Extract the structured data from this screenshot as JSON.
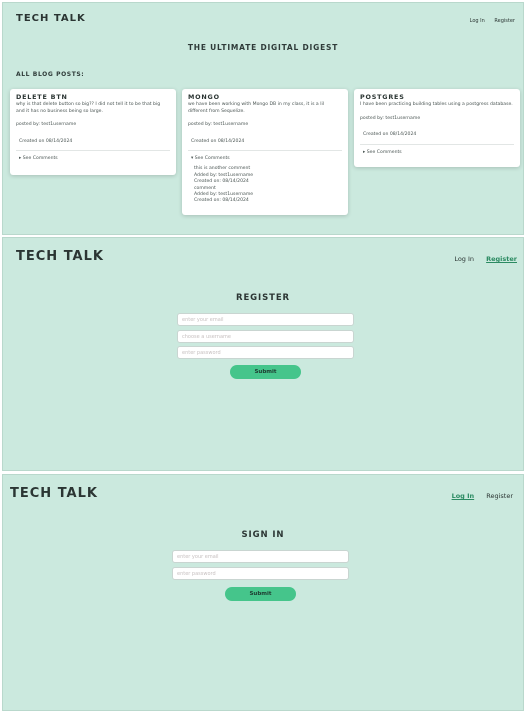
{
  "home": {
    "brand": "Tech Talk",
    "nav": {
      "login": "Log In",
      "register": "Register"
    },
    "title": "The Ultimate Digital Digest",
    "posts_heading": "All Blog Posts:",
    "posts": [
      {
        "title": "Delete BTN",
        "body": "why is that delete button so big?? I did not tell it to be that big and it has no business being so large.",
        "posted_by": "posted by: test1username",
        "created": "Created on 08/14/2024",
        "toggle": "▸ See Comments"
      },
      {
        "title": "Mongo",
        "body": "we have been working with Mongo DB in my class, it is a lil different from Sequelize.",
        "posted_by": "posted by: test1username",
        "created": "Created on 08/14/2024",
        "toggle": "▾ See Comments",
        "comments": [
          {
            "text": "this is another comment",
            "added_by": "Added by: test1username",
            "created": "Created on: 08/14/2024"
          },
          {
            "text": "comment",
            "added_by": "Added by: test1username",
            "created": "Created on: 08/14/2024"
          }
        ]
      },
      {
        "title": "Postgres",
        "body": "I have been practicing building tables using a postgress database.",
        "posted_by": "posted by: test1username",
        "created": "Created on 08/14/2024",
        "toggle": "▸ See Comments"
      }
    ]
  },
  "register_page": {
    "brand": "Tech Talk",
    "nav": {
      "login": "Log In",
      "register": "Register"
    },
    "title": "Register",
    "email_placeholder": "enter your email",
    "username_placeholder": "choose a username",
    "password_placeholder": "enter password",
    "submit": "Submit"
  },
  "login_page": {
    "brand": "Tech Talk",
    "nav": {
      "login": "Log In",
      "register": "Register"
    },
    "title": "Sign In",
    "email_placeholder": "enter your email",
    "password_placeholder": "enter password",
    "submit": "Submit"
  },
  "colors": {
    "background": "#cbe9de",
    "accent_button": "#45c58b",
    "active_link": "#2a8a61"
  }
}
